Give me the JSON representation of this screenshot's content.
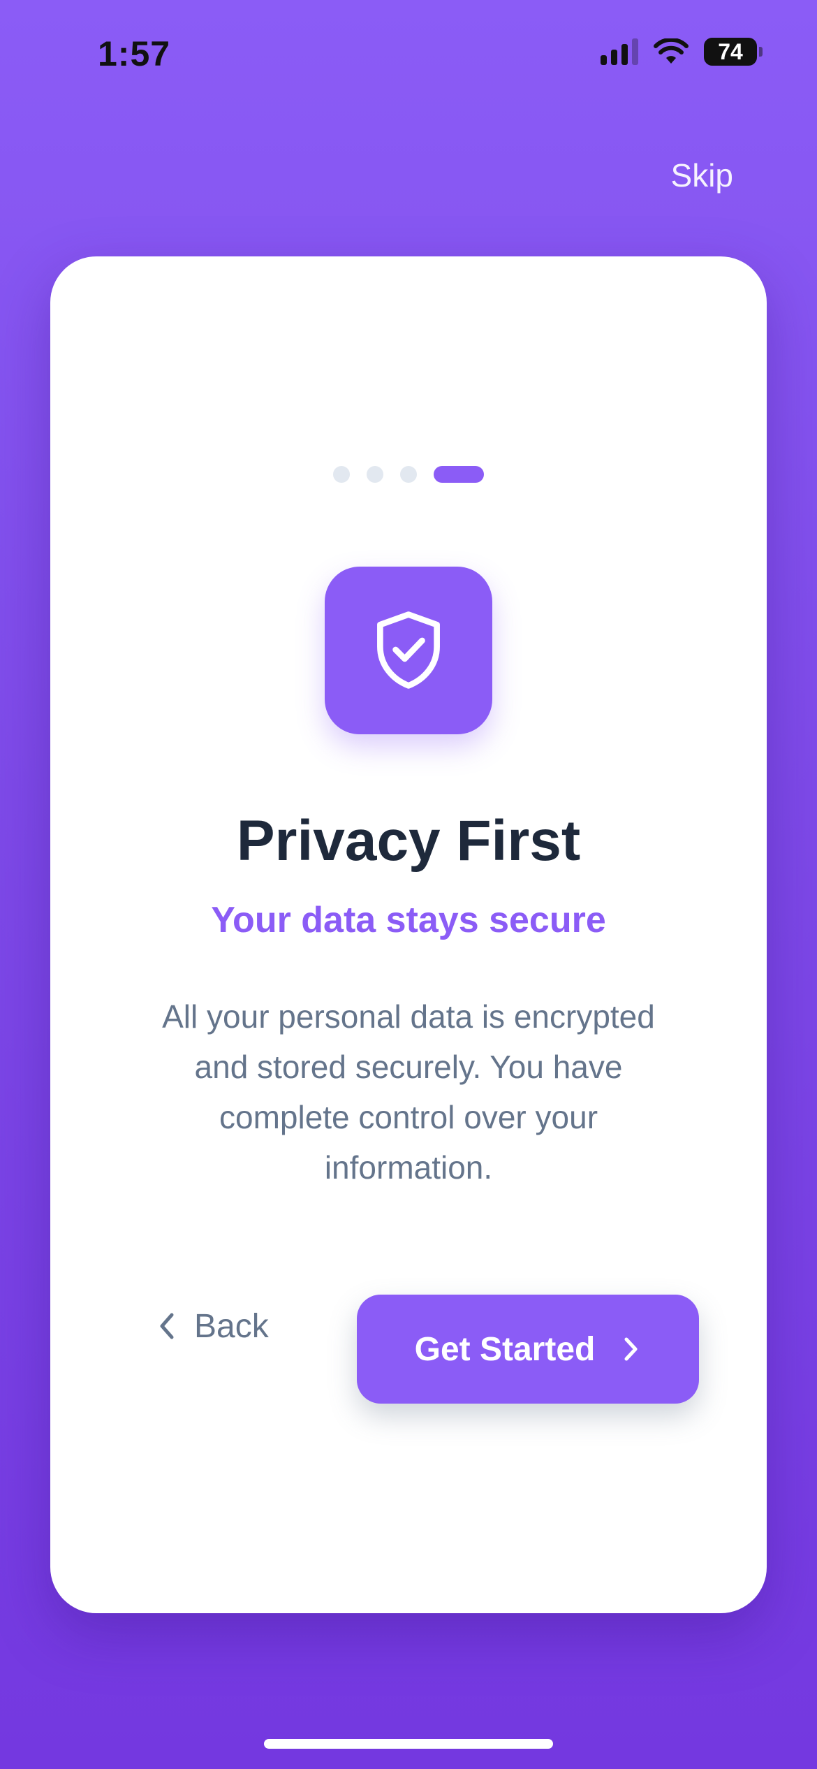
{
  "status_bar": {
    "time": "1:57",
    "battery": "74",
    "icons": [
      "signal-icon",
      "wifi-icon",
      "battery-icon"
    ]
  },
  "header": {
    "skip_label": "Skip"
  },
  "onboarding": {
    "page_count": 4,
    "current_page": 4,
    "icon": "shield-check-icon",
    "title": "Privacy First",
    "subtitle": "Your data stays secure",
    "description": "All your personal data is encrypted and stored securely. You have complete control over your information."
  },
  "actions": {
    "back_label": "Back",
    "back_icon": "chevron-left-icon",
    "primary_label": "Get Started",
    "primary_icon": "chevron-right-icon"
  },
  "colors": {
    "accent": "#8b5cf6",
    "background_top": "#8b5cf6",
    "background_bottom": "#7438e0",
    "title": "#1e293b",
    "body_text": "#64748b",
    "inactive_dot": "#e2e8f0"
  }
}
